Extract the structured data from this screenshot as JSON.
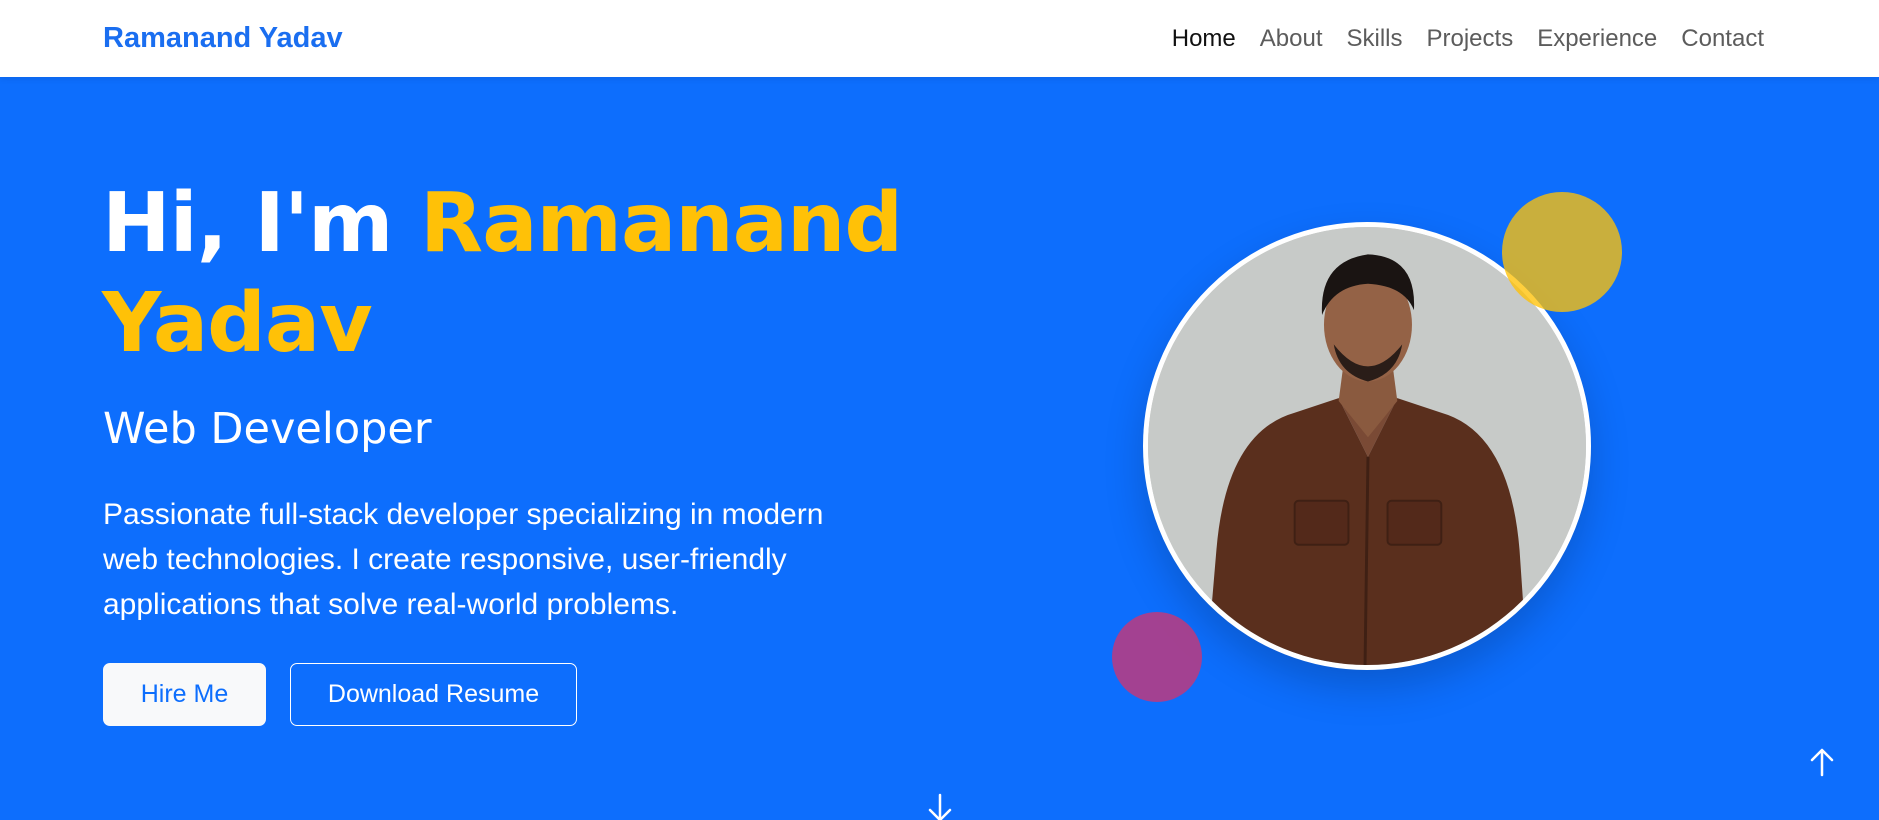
{
  "navbar": {
    "brand": "Ramanand Yadav",
    "links": [
      "Home",
      "About",
      "Skills",
      "Projects",
      "Experience",
      "Contact"
    ],
    "active": "Home"
  },
  "hero": {
    "greeting": "Hi, I'm ",
    "name": "Ramanand Yadav",
    "role": "Web Developer",
    "description": "Passionate full-stack developer specializing in modern web technologies. I create responsive, user-friendly applications that solve real-world problems.",
    "hire_label": "Hire Me",
    "resume_label": "Download Resume"
  },
  "icons": {
    "scroll_down": "arrow-down-icon",
    "back_to_top": "arrow-up-icon"
  },
  "colors": {
    "primary": "#0d6efd",
    "accent": "#ffc107",
    "pink": "#d6336c",
    "white": "#ffffff"
  }
}
